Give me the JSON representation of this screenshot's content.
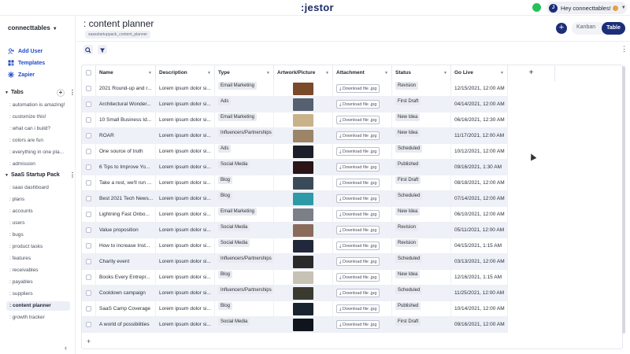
{
  "app": {
    "logo": ":jestor",
    "user_greeting": "Hey connecttables!",
    "user_initial": "J"
  },
  "sidebar": {
    "workspace": "connecttables",
    "links": [
      {
        "label": "Add User",
        "icon": "add-user-icon"
      },
      {
        "label": "Templates",
        "icon": "templates-icon"
      },
      {
        "label": "Zapier",
        "icon": "zapier-icon"
      }
    ],
    "tabs_section": {
      "title": "Tabs",
      "items": [
        ": automation is amazing!",
        ": customize this!",
        ": what can i build?",
        ": colors are fun",
        ": everything in one pla...",
        ": admission"
      ]
    },
    "pack_section": {
      "title": "SaaS Startup Pack",
      "items": [
        ": saas dashboard",
        ": plans",
        ": accounts",
        ": users",
        ": bugs",
        ": product tasks",
        ": features",
        ": receivables",
        ": payables",
        ": suppliers",
        ": content planner",
        ": growth tracker"
      ],
      "active_index": 10
    }
  },
  "header": {
    "title": ": content planner",
    "breadcrumb": "saasstartuppack_content_planner",
    "add_label": "+",
    "views": {
      "kanban": "Kanban",
      "table": "Table"
    }
  },
  "table": {
    "columns": [
      "Name",
      "Description",
      "Type",
      "Artwork/Picture",
      "Attachment",
      "Status",
      "Go Live"
    ],
    "download_label": "Download file .jpg",
    "rows": [
      {
        "name": "2021 Round-up and r...",
        "desc": "Lorem ipsum dolor si...",
        "type": "Email Marketing",
        "status": "Revision",
        "golive": "12/15/2021, 12:00 AM",
        "thumb": "#7a4a2a"
      },
      {
        "name": "Architectural Wonder...",
        "desc": "Lorem ipsum dolor si...",
        "type": "Ads",
        "status": "First Draft",
        "golive": "04/14/2021, 12:00 AM",
        "thumb": "#556070"
      },
      {
        "name": "10 Small Business Id...",
        "desc": "Lorem ipsum dolor si...",
        "type": "Email Marketing",
        "status": "New Idea",
        "golive": "06/16/2021, 12:30 AM",
        "thumb": "#c9b28a"
      },
      {
        "name": "ROAR",
        "desc": "Lorem ipsum dolor si...",
        "type": "Influencers/Partnerships",
        "status": "New Idea",
        "golive": "11/17/2021, 12:00 AM",
        "thumb": "#9c8466"
      },
      {
        "name": "One source of truth",
        "desc": "Lorem ipsum dolor si...",
        "type": "Ads",
        "status": "Scheduled",
        "golive": "10/12/2021, 12:00 AM",
        "thumb": "#1a1f2a"
      },
      {
        "name": "6 Tips to Improve Yo...",
        "desc": "Lorem ipsum dolor si...",
        "type": "Social Media",
        "status": "Published",
        "golive": "09/16/2021, 1:30 AM",
        "thumb": "#2a1418"
      },
      {
        "name": "Take a rest, we'll run ...",
        "desc": "Lorem ipsum dolor si...",
        "type": "Blog",
        "status": "First Draft",
        "golive": "08/18/2021, 12:00 AM",
        "thumb": "#3a4a5a"
      },
      {
        "name": "Best 2021 Tech News...",
        "desc": "Lorem ipsum dolor si...",
        "type": "Blog",
        "status": "Scheduled",
        "golive": "07/14/2021, 12:00 AM",
        "thumb": "#2e9aa8"
      },
      {
        "name": "Lightning Fast Onbo...",
        "desc": "Lorem ipsum dolor si...",
        "type": "Email Marketing",
        "status": "New Idea",
        "golive": "06/10/2021, 12:00 AM",
        "thumb": "#7a7f88"
      },
      {
        "name": "Value proposition",
        "desc": "Lorem ipsum dolor si...",
        "type": "Social Media",
        "status": "Revision",
        "golive": "05/11/2021, 12:00 AM",
        "thumb": "#8a6a5a"
      },
      {
        "name": "How to increase Inst...",
        "desc": "Lorem ipsum dolor si...",
        "type": "Social Media",
        "status": "Revision",
        "golive": "04/15/2021, 1:15 AM",
        "thumb": "#20283a"
      },
      {
        "name": "Charity event",
        "desc": "Lorem ipsum dolor si...",
        "type": "Influencers/Partnerships",
        "status": "Scheduled",
        "golive": "03/13/2021, 12:00 AM",
        "thumb": "#2a2a2a"
      },
      {
        "name": "Books Every Entrepr...",
        "desc": "Lorem ipsum dolor si...",
        "type": "Blog",
        "status": "New Idea",
        "golive": "12/16/2021, 1:15 AM",
        "thumb": "#c7c2b6"
      },
      {
        "name": "Cooldown campaign",
        "desc": "Lorem ipsum dolor si...",
        "type": "Influencers/Partnerships",
        "status": "Scheduled",
        "golive": "11/25/2021, 12:00 AM",
        "thumb": "#3a3a30"
      },
      {
        "name": "SaaS Camp Coverage",
        "desc": "Lorem ipsum dolor si...",
        "type": "Blog",
        "status": "Published",
        "golive": "10/14/2021, 12:00 AM",
        "thumb": "#1a2430"
      },
      {
        "name": "A world of possibilities",
        "desc": "Lorem ipsum dolor si...",
        "type": "Social Media",
        "status": "First Draft",
        "golive": "09/16/2021, 12:00 AM",
        "thumb": "#10141c"
      }
    ]
  }
}
